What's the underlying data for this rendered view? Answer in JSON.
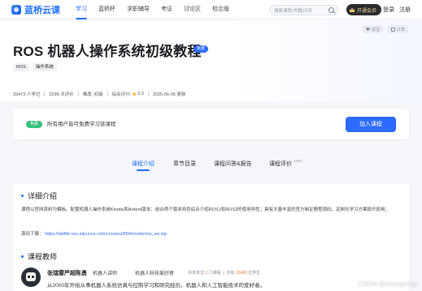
{
  "header": {
    "logo_text": "蓝桥云课",
    "nav": [
      "学习",
      "蓝桥杯",
      "求职辅导",
      "考证",
      "讨论区",
      "校企版"
    ],
    "search_placeholder": "搜索课程/书籍/问答",
    "vip_label": "开通会员",
    "login": "登录",
    "register": "注册"
  },
  "hero": {
    "follow": "关注",
    "share": "分享",
    "title": "ROS 机器人操作系统初级教程",
    "free_badge": "免费",
    "tags": [
      "ROS",
      "操作系统"
    ],
    "stats": {
      "learners": "29473 人学过",
      "reviews": "2299 次评价",
      "difficulty": "难度: 初级",
      "rating_label": "综合评分:",
      "rating": "9.3",
      "updated": "2025-06-05 更新"
    }
  },
  "join": {
    "badge": "免费",
    "text": "所有用户皆可免费学习该课程",
    "button": "加入课程"
  },
  "tabs": [
    {
      "label": "课程介绍",
      "sup": ""
    },
    {
      "label": "章节目录",
      "sup": ""
    },
    {
      "label": "课程问答&报告",
      "sup": ""
    },
    {
      "label": "课程评价",
      "sup": "2299"
    }
  ],
  "detail": {
    "title": "详细介绍",
    "paragraph": "课程以官网资料为模板。配置机器人操作系统Kinetic和Ardent版本：结合两个版本特色综合介绍ROS1和ROS2的使用特性；具有大量丰富的官方制定教程源码。定制化学习方案即开即用；",
    "source_label": "源码下载：",
    "source_link": "https://labfile.oss.aliyuncs.com/courses/854/rosdemos_ws.zip"
  },
  "teacher": {
    "section_title": "课程教师",
    "name": "张瑞雷严超陈勇",
    "role1": "机器人讲师",
    "role2": "机器人科技爱好者",
    "courses_prefix": "共发布过",
    "courses": "2",
    "courses_suffix": "门课程",
    "learners_prefix": "共有",
    "learners": "22480",
    "learners_suffix": "位学生",
    "bio": "从2000年开始从事机器人系统仿真与控制学习和研究经历。机器人和人工智能技术的爱好者。"
  },
  "watermark": "CSDN @zhangrelay"
}
